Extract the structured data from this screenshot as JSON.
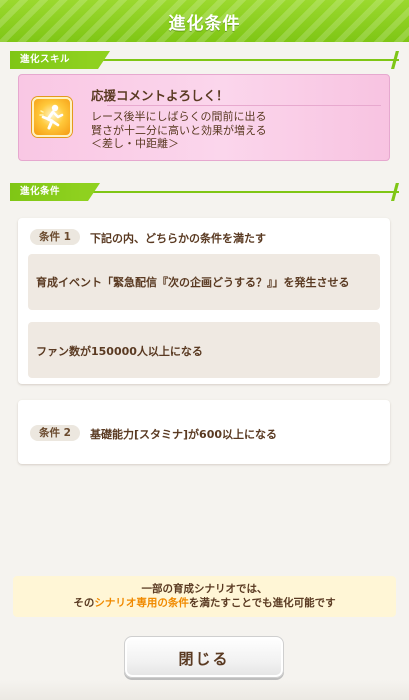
{
  "dialog": {
    "title": "進化条件",
    "skill_section_label": "進化スキル",
    "conditions_section_label": "進化条件",
    "accent_color": "#7fc615"
  },
  "skill": {
    "name": "応援コメントよろしく！",
    "description_lines": [
      "レース後半にしばらくの間前に出る",
      "賢さが十二分に高いと効果が増える",
      "＜差し・中距離＞"
    ],
    "icon": "running-figure-skill-icon"
  },
  "conditions": [
    {
      "badge": "条件 1",
      "label": "下記の内、どちらかの条件を満たす",
      "options": [
        "育成イベント「緊急配信『次の企画どうする？』」を発生させる",
        "ファン数が150000人以上になる"
      ]
    },
    {
      "badge": "条件 2",
      "label": "基礎能力[スタミナ]が600以上になる"
    }
  ],
  "notice": {
    "line1": "一部の育成シナリオでは、",
    "line2_pre": "その",
    "line2_highlight1": "シナリオ",
    "line2_highlight2": "専用の条件",
    "line2_post": "を満たすことでも進化可能です",
    "highlight_color": "#f08a00"
  },
  "close_button": {
    "label": "閉じる"
  }
}
